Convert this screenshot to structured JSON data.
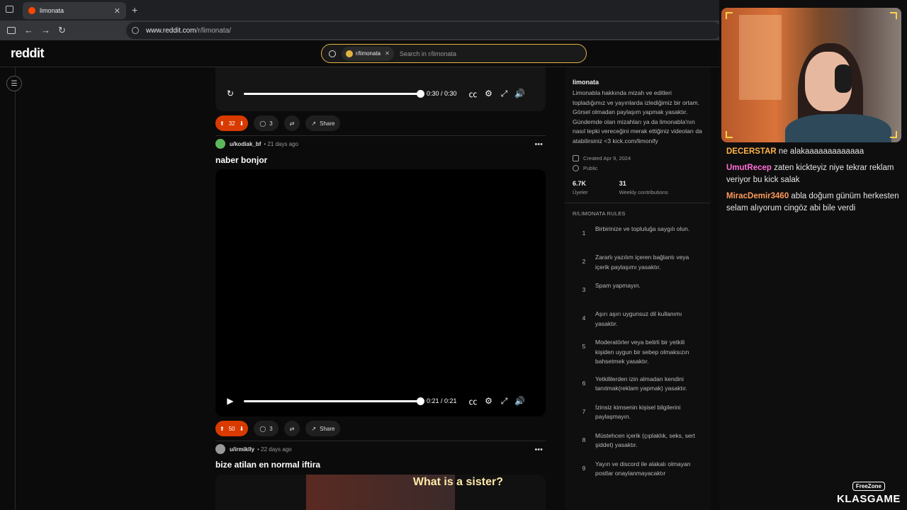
{
  "browser": {
    "tab_title": "limonata",
    "url_host": "www.reddit.com",
    "url_path": "/r/limonata/"
  },
  "header": {
    "logo": "reddit",
    "search_chip": "r/limonata",
    "search_placeholder": "Search in r/limonata"
  },
  "feed": {
    "posts": [
      {
        "time": "0:30 / 0:30",
        "votes": "32",
        "comments": "3",
        "share": "Share",
        "progress": 1.0
      },
      {
        "user": "u/kodiak_bf",
        "age": "• 21 days ago",
        "title": "naber bonjor",
        "time": "0:21 / 0:21",
        "votes": "50",
        "comments": "3",
        "share": "Share",
        "progress": 1.0
      },
      {
        "user": "u/irmiklly",
        "age": "• 22 days ago",
        "title": "bize atilan en normal iftira",
        "thumb_text": "What is a sister?"
      }
    ]
  },
  "sidebar": {
    "name": "limonata",
    "description": "Limonabla hakkında mizah ve editleri topladığımız ve yayınlarda izlediğimiz bir ortam. Görsel olmadan paylaşım yapmak yasaktır. Gündemde olan mizahları ya da limonabla'nın nasıl tepki vereceğini merak ettiğiniz videoları da atabilirsiniz <3 kick.com/limonify",
    "created": "Created Apr 9, 2024",
    "visibility": "Public",
    "members_count": "6.7K",
    "members_label": "Üyeler",
    "contrib_count": "31",
    "contrib_label": "Weekly contributions",
    "rules_heading": "R/LIMONATA RULES",
    "rules": [
      {
        "n": "1",
        "t": "Birbirinize ve topluluğa saygılı olun."
      },
      {
        "n": "2",
        "t": "Zararlı yazılım içeren bağlantı veya içerik paylaşımı yasaktır."
      },
      {
        "n": "3",
        "t": "Spam yapmayın."
      },
      {
        "n": "4",
        "t": "Aşırı aşırı uygunsuz dil kullanımı yasaktır."
      },
      {
        "n": "5",
        "t": "Moderatörler veya belirli bir yetkili kişiden uygun bir sebep olmaksızın bahsetmek yasaktır."
      },
      {
        "n": "6",
        "t": "Yetkililerden izin almadan kendini tanıtmak(reklam yapmak) yasaktır."
      },
      {
        "n": "7",
        "t": "İzinsiz kimsenin kişisel bilgilerini paylaşmayın."
      },
      {
        "n": "8",
        "t": "Müstehcen içerik (çıplaklık, seks, sert şiddet) yasaktır."
      },
      {
        "n": "9",
        "t": "Yayın ve discord ile alakalı olmayan postlar onaylanmayacaktır"
      }
    ]
  },
  "stream": {
    "chat": [
      {
        "user": "DECERSTAR",
        "text": " ne alakaaaaaaaaaaaaa",
        "color": "#ffb347"
      },
      {
        "user": "UmutRecep",
        "text": " zaten kickteyiz niye tekrar reklam veriyor bu kick salak",
        "color": "#ff6fd8"
      },
      {
        "user": "MiracDemir3460",
        "text": " abla doğum günüm herkesten selam alıyorum cingöz abi bile verdi",
        "color": "#ff9a5a"
      }
    ],
    "brand_small": "FreeZone",
    "brand_big": "KLASGAME"
  },
  "colors": {
    "accent": "#d93a00",
    "search_border": "#e3b341"
  }
}
